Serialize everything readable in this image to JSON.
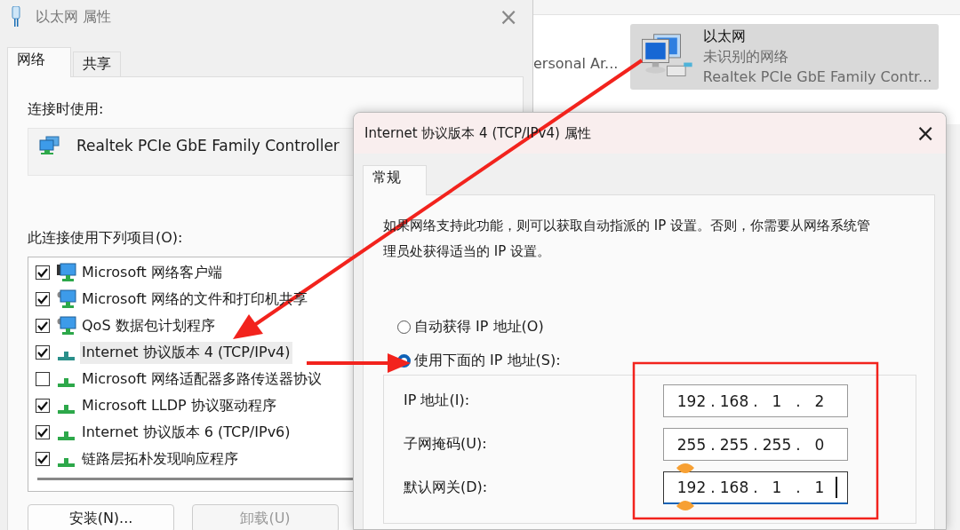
{
  "back_window": {
    "partial_item": {
      "label": "ersonal Ar..."
    },
    "adapter": {
      "name": "以太网",
      "status": "未识别的网络",
      "device": "Realtek PCIe GbE Family Contr...",
      "selected": true
    }
  },
  "ethernet_dialog": {
    "title": "以太网 属性",
    "close": "×",
    "tabs": [
      {
        "label": "网络",
        "selected": true
      },
      {
        "label": "共享",
        "selected": false
      }
    ],
    "connect_using_label": "连接时使用:",
    "adapter_name": "Realtek PCIe GbE Family Controller",
    "items_label": "此连接使用下列项目(O):",
    "items": [
      {
        "label": "Microsoft 网络客户端",
        "checked": true,
        "selected": false,
        "kind": "client"
      },
      {
        "label": "Microsoft 网络的文件和打印机共享",
        "checked": true,
        "selected": false,
        "kind": "service"
      },
      {
        "label": "QoS 数据包计划程序",
        "checked": true,
        "selected": false,
        "kind": "service"
      },
      {
        "label": "Internet 协议版本 4 (TCP/IPv4)",
        "checked": true,
        "selected": true,
        "kind": "protocol"
      },
      {
        "label": "Microsoft 网络适配器多路传送器协议",
        "checked": false,
        "selected": false,
        "kind": "protocol"
      },
      {
        "label": "Microsoft LLDP 协议驱动程序",
        "checked": true,
        "selected": false,
        "kind": "protocol"
      },
      {
        "label": "Internet 协议版本 6 (TCP/IPv6)",
        "checked": true,
        "selected": false,
        "kind": "protocol"
      },
      {
        "label": "链路层拓朴发现响应程序",
        "checked": true,
        "selected": false,
        "kind": "protocol"
      }
    ],
    "buttons": [
      {
        "label": "安装(N)...",
        "disabled": false
      },
      {
        "label": "卸载(U)",
        "disabled": true
      }
    ]
  },
  "ipv4_dialog": {
    "title": "Internet 协议版本 4 (TCP/IPv4) 属性",
    "close": "×",
    "tabs": [
      {
        "label": "常规",
        "selected": true
      }
    ],
    "description": "如果网络支持此功能，则可以获取自动指派的 IP 设置。否则，你需要从网络系统管理员处获得适当的 IP 设置。",
    "radios": [
      {
        "label": "自动获得 IP 地址(O)",
        "selected": false
      },
      {
        "label": "使用下面的 IP 地址(S):",
        "selected": true
      }
    ],
    "separator": ".",
    "fields": [
      {
        "label": "IP 地址(I):",
        "octets": [
          "192",
          "168",
          "1",
          "2"
        ],
        "focused": false
      },
      {
        "label": "子网掩码(U):",
        "octets": [
          "255",
          "255",
          "255",
          "0"
        ],
        "focused": false
      },
      {
        "label": "默认网关(D):",
        "octets": [
          "192",
          "168",
          "1",
          "1"
        ],
        "focused": true
      }
    ]
  }
}
